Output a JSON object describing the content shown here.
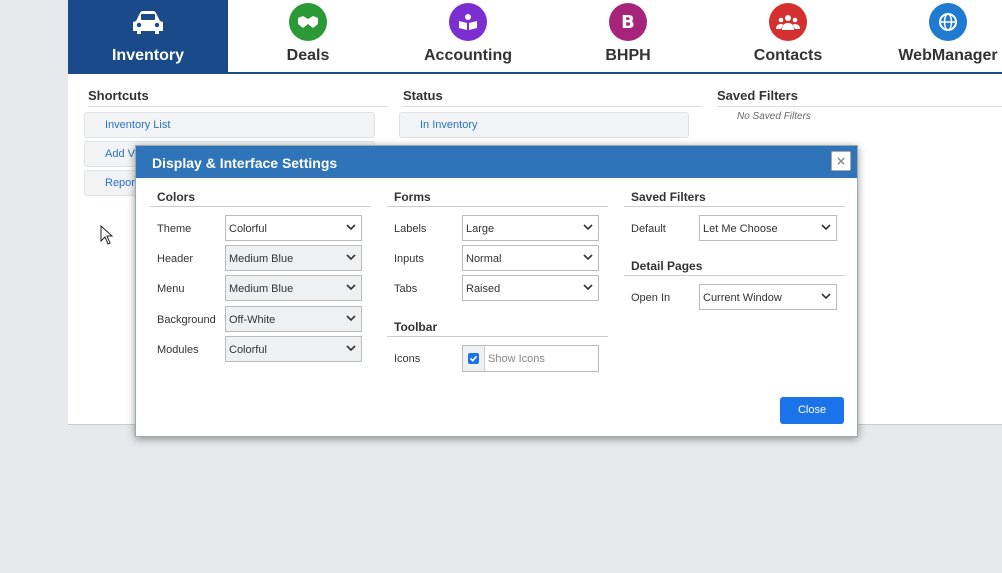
{
  "nav": {
    "items": [
      {
        "label": "Inventory",
        "color": "#1b4a8a",
        "icon": "car-icon"
      },
      {
        "label": "Deals",
        "color": "#2a9a36",
        "icon": "handshake-icon"
      },
      {
        "label": "Accounting",
        "color": "#7b2fd0",
        "icon": "book-icon"
      },
      {
        "label": "BHPH",
        "color": "#a6247a",
        "icon": "b-letter-icon",
        "glyph": "B"
      },
      {
        "label": "Contacts",
        "color": "#d43030",
        "icon": "people-icon"
      },
      {
        "label": "WebManager",
        "color": "#1f7ad0",
        "icon": "globe-icon"
      }
    ]
  },
  "panel": {
    "shortcuts": {
      "title": "Shortcuts",
      "items": [
        "Inventory List",
        "Add V",
        "Repor"
      ]
    },
    "status": {
      "title": "Status",
      "items": [
        "In Inventory"
      ]
    },
    "saved_filters": {
      "title": "Saved Filters",
      "empty": "No Saved Filters"
    }
  },
  "modal": {
    "title": "Display & Interface Settings",
    "close_x": "×",
    "colors": {
      "title": "Colors",
      "rows": [
        {
          "label": "Theme",
          "value": "Colorful"
        },
        {
          "label": "Header",
          "value": "Medium Blue"
        },
        {
          "label": "Menu",
          "value": "Medium Blue"
        },
        {
          "label": "Background",
          "value": "Off-White"
        },
        {
          "label": "Modules",
          "value": "Colorful"
        }
      ]
    },
    "forms": {
      "title": "Forms",
      "rows": [
        {
          "label": "Labels",
          "value": "Large"
        },
        {
          "label": "Inputs",
          "value": "Normal"
        },
        {
          "label": "Tabs",
          "value": "Raised"
        }
      ]
    },
    "toolbar": {
      "title": "Toolbar",
      "icons_label": "Icons",
      "icons_checkbox": "Show Icons"
    },
    "saved_filters": {
      "title": "Saved Filters",
      "default_label": "Default",
      "default_value": "Let Me Choose"
    },
    "detail_pages": {
      "title": "Detail Pages",
      "open_in_label": "Open In",
      "open_in_value": "Current Window"
    },
    "close_button": "Close"
  }
}
